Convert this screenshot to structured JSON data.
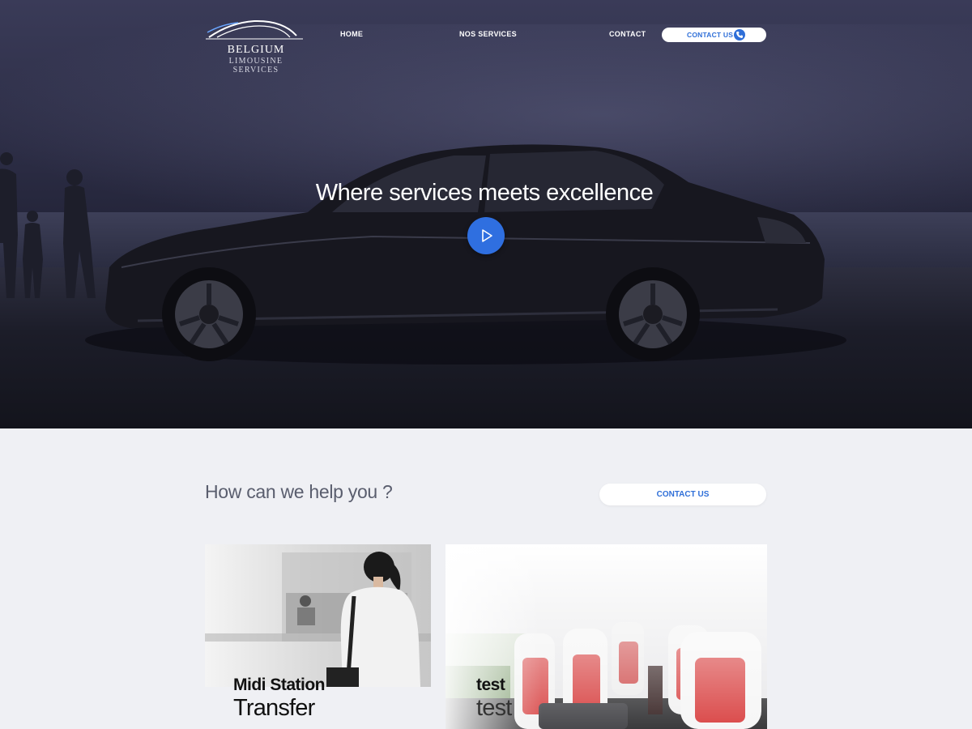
{
  "brand": {
    "name": "BELGIUM",
    "tagline": "LIMOUSINE SERVICES"
  },
  "nav": {
    "home": "HOME",
    "services": "NOS  SERVICES",
    "contact": "CONTACT",
    "cta_label": "CONTACT US"
  },
  "hero": {
    "title": "Where services meets excellence"
  },
  "help": {
    "title": "How can we help you ?",
    "contact_label": "CONTACT US"
  },
  "cards": [
    {
      "name": "Midi Station",
      "subtitle": "Transfer"
    },
    {
      "name": "test",
      "subtitle": "test"
    }
  ],
  "colors": {
    "accent": "#2f6fd8",
    "hero_dark": "#2c2d45",
    "page_bg": "#eff0f4"
  },
  "icons": {
    "logo": "car-silhouette-logo",
    "play": "play-icon",
    "phone": "phone-icon"
  }
}
